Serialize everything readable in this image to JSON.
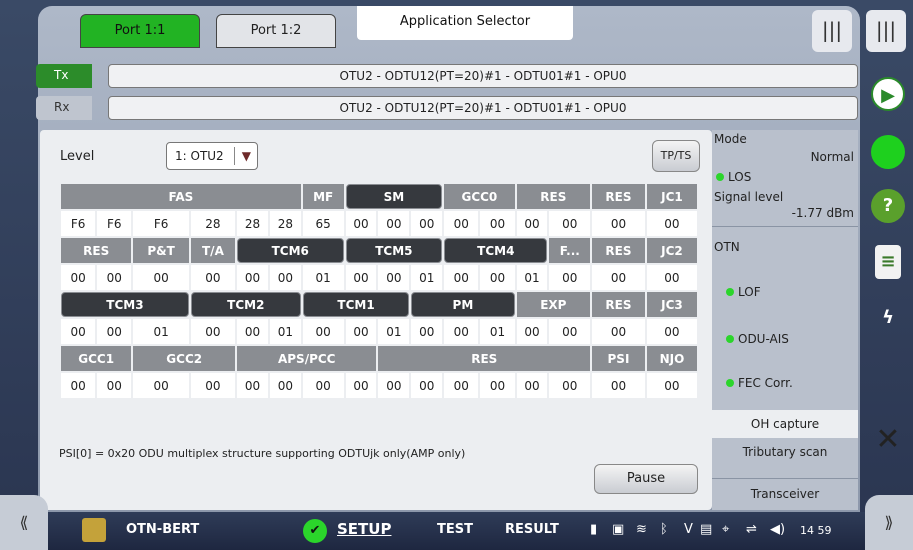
{
  "tabs": [
    {
      "label": "Port 1:1"
    },
    {
      "label": "Port 1:2"
    }
  ],
  "app_selector": "Application Selector",
  "tx": {
    "label": "Tx",
    "path": "OTU2 - ODTU12(PT=20)#1 - ODTU01#1 - OPU0"
  },
  "rx": {
    "label": "Rx",
    "path": "OTU2 - ODTU12(PT=20)#1 - ODTU01#1 - OPU0"
  },
  "level": {
    "label": "Level",
    "value": "1: OTU2"
  },
  "tpts_label": "TP/TS",
  "table": {
    "row1": {
      "headers": [
        "FAS",
        "MF",
        "SM",
        "GCC0",
        "RES",
        "RES",
        "JC1"
      ],
      "values": [
        "F6",
        "F6",
        "F6",
        "28",
        "28",
        "28",
        "65",
        "00",
        "00",
        "00",
        "00",
        "00",
        "00",
        "00",
        "00",
        "00"
      ]
    },
    "row2": {
      "headers": [
        "RES",
        "P&T",
        "T/A",
        "TCM6",
        "TCM5",
        "TCM4",
        "F...",
        "RES",
        "JC2"
      ],
      "values": [
        "00",
        "00",
        "00",
        "00",
        "00",
        "00",
        "01",
        "00",
        "00",
        "01",
        "00",
        "00",
        "01",
        "00",
        "00",
        "00"
      ]
    },
    "row3": {
      "headers": [
        "TCM3",
        "TCM2",
        "TCM1",
        "PM",
        "EXP",
        "RES",
        "JC3"
      ],
      "values": [
        "00",
        "00",
        "01",
        "00",
        "00",
        "01",
        "00",
        "00",
        "01",
        "00",
        "00",
        "01",
        "00",
        "00",
        "00",
        "00"
      ]
    },
    "row4": {
      "headers": [
        "GCC1",
        "GCC2",
        "APS/PCC",
        "RES",
        "PSI",
        "NJO"
      ],
      "values": [
        "00",
        "00",
        "00",
        "00",
        "00",
        "00",
        "00",
        "00",
        "00",
        "00",
        "00",
        "00",
        "00",
        "00",
        "00",
        "00"
      ]
    }
  },
  "psi_text": "PSI[0] = 0x20 ODU multiplex structure supporting ODTUjk only(AMP only)",
  "pause_label": "Pause",
  "right_panel": {
    "mode_label": "Mode",
    "mode_value": "Normal",
    "los": "LOS",
    "signal_label": "Signal level",
    "signal_value": "-1.77 dBm",
    "otn_label": "OTN",
    "lof": "LOF",
    "odu_ais": "ODU-AIS",
    "fec": "FEC Corr.",
    "tabs": [
      "OH capture",
      "Tributary scan",
      "Transceiver"
    ]
  },
  "bottom": {
    "app": "OTN-BERT",
    "setup": "SETUP",
    "test": "TEST",
    "result": "RESULT",
    "time": "14 59"
  },
  "colors": {
    "accent_green": "#22b323",
    "status_green": "#2bd52b"
  }
}
